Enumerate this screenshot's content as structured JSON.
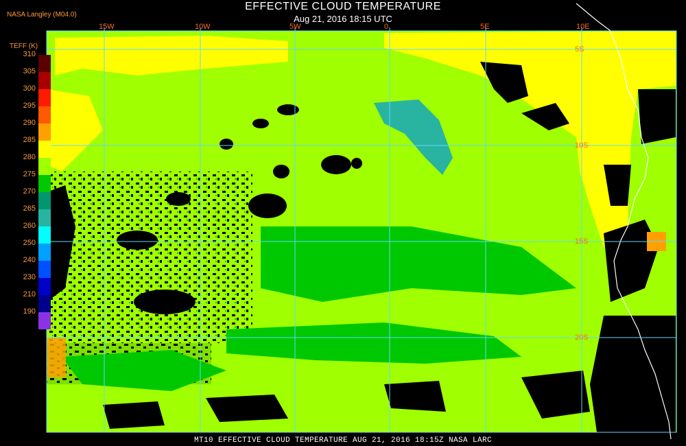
{
  "header": {
    "title": "EFFECTIVE CLOUD TEMPERATURE",
    "subtitle": "Aug 21, 2016 18:15 UTC",
    "source": "NASA Langley (M04.0)"
  },
  "legend": {
    "title": "TEFF (K)",
    "ticks": [
      "310",
      "305",
      "300",
      "295",
      "290",
      "285",
      "280",
      "275",
      "270",
      "265",
      "260",
      "250",
      "240",
      "230",
      "210",
      "190"
    ],
    "colors": [
      "#5a0000",
      "#a80000",
      "#ff1a00",
      "#ff5a00",
      "#ffa000",
      "#ffff00",
      "#a0ff00",
      "#00c800",
      "#00966e",
      "#28b4a0",
      "#00ffff",
      "#00a0ff",
      "#0050ff",
      "#0000c8",
      "#00008c",
      "#8c32e6"
    ]
  },
  "grid": {
    "longitudes": [
      "15W",
      "10W",
      "5W",
      "0",
      "5E",
      "10E"
    ],
    "latitudes": [
      "5S",
      "10S",
      "15S",
      "20S"
    ]
  },
  "footer": {
    "text": "MT10  EFFECTIVE CLOUD TEMPERATURE  AUG 21, 2016 18:15Z  NASA LARC"
  },
  "colors": {
    "background": "#000000",
    "grid": "#5fd7ff",
    "label": "#ff6a2a",
    "coast": "#ffffff",
    "cloud_warm": "#ffff00",
    "cloud_mid": "#a0ff00",
    "cloud_cool": "#00c800",
    "cloud_cold": "#28b4a0"
  }
}
